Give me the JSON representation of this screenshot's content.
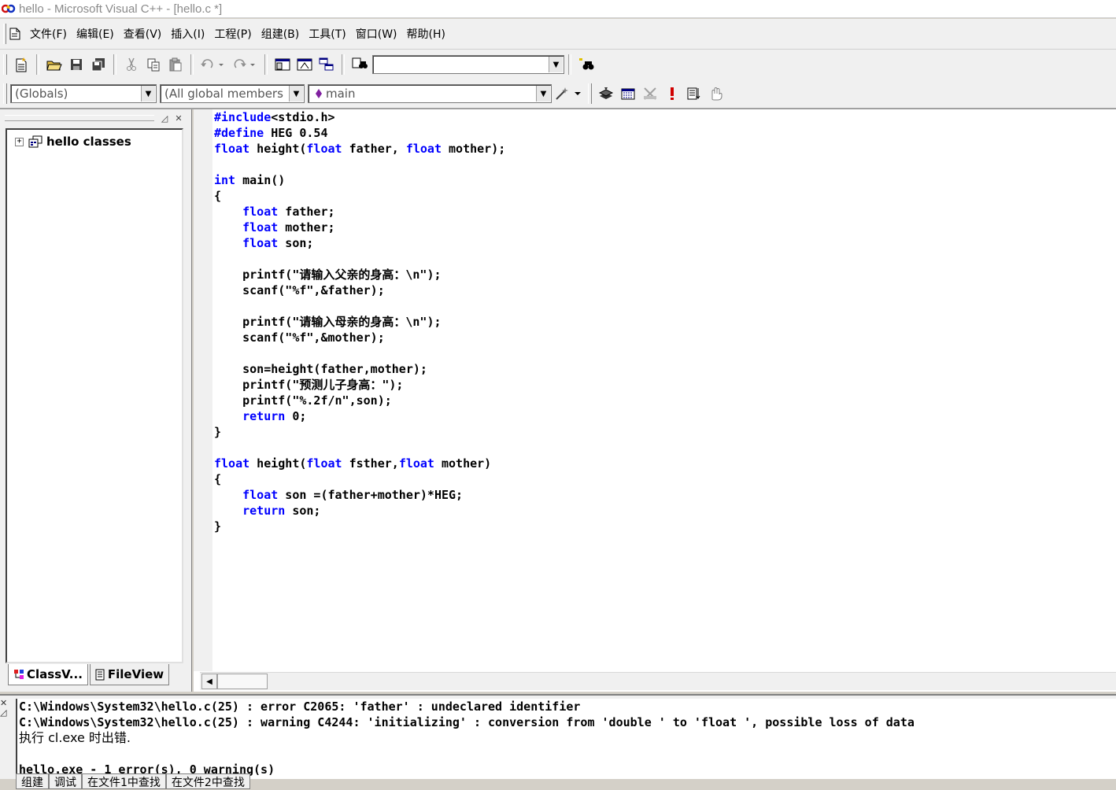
{
  "window": {
    "title": "hello - Microsoft Visual C++ - [hello.c *]"
  },
  "menu": [
    "文件(F)",
    "编辑(E)",
    "查看(V)",
    "插入(I)",
    "工程(P)",
    "组建(B)",
    "工具(T)",
    "窗口(W)",
    "帮助(H)"
  ],
  "toolbar": {
    "find_value": "",
    "scope_value": "(Globals)",
    "members_value": "(All global members",
    "function_value": "main"
  },
  "workspace": {
    "tree_root": "hello classes",
    "tabs": [
      "ClassV...",
      "FileView"
    ]
  },
  "editor": {
    "lines": [
      "#include<stdio.h>",
      "#define HEG 0.54",
      "float height(float father, float mother);",
      "",
      "int main()",
      "{",
      "    float father;",
      "    float mother;",
      "    float son;",
      "",
      "    printf(\"请输入父亲的身高：\\n\");",
      "    scanf(\"%f\",&father);",
      "",
      "    printf(\"请输入母亲的身高：\\n\");",
      "    scanf(\"%f\",&mother);",
      "",
      "    son=height(father,mother);",
      "    printf(\"预测儿子身高：\");",
      "    printf(\"%.2f/n\",son);",
      "    return 0;",
      "}",
      "",
      "float height(float fsther,float mother)",
      "{",
      "    float son =(father+mother)*HEG;",
      "    return son;",
      "}"
    ],
    "keywords": [
      "#include",
      "#define",
      "float",
      "int",
      "return"
    ]
  },
  "output": {
    "lines": [
      "C:\\Windows\\System32\\hello.c(25) : error C2065: 'father' : undeclared identifier",
      "C:\\Windows\\System32\\hello.c(25) : warning C4244: 'initializing' : conversion from 'double ' to 'float ', possible loss of data",
      "执行 cl.exe 时出错.",
      "",
      "hello.exe - 1 error(s), 0 warning(s)"
    ],
    "tabs": [
      "组建",
      "调试",
      "在文件1中查找",
      "在文件2中查找"
    ]
  }
}
